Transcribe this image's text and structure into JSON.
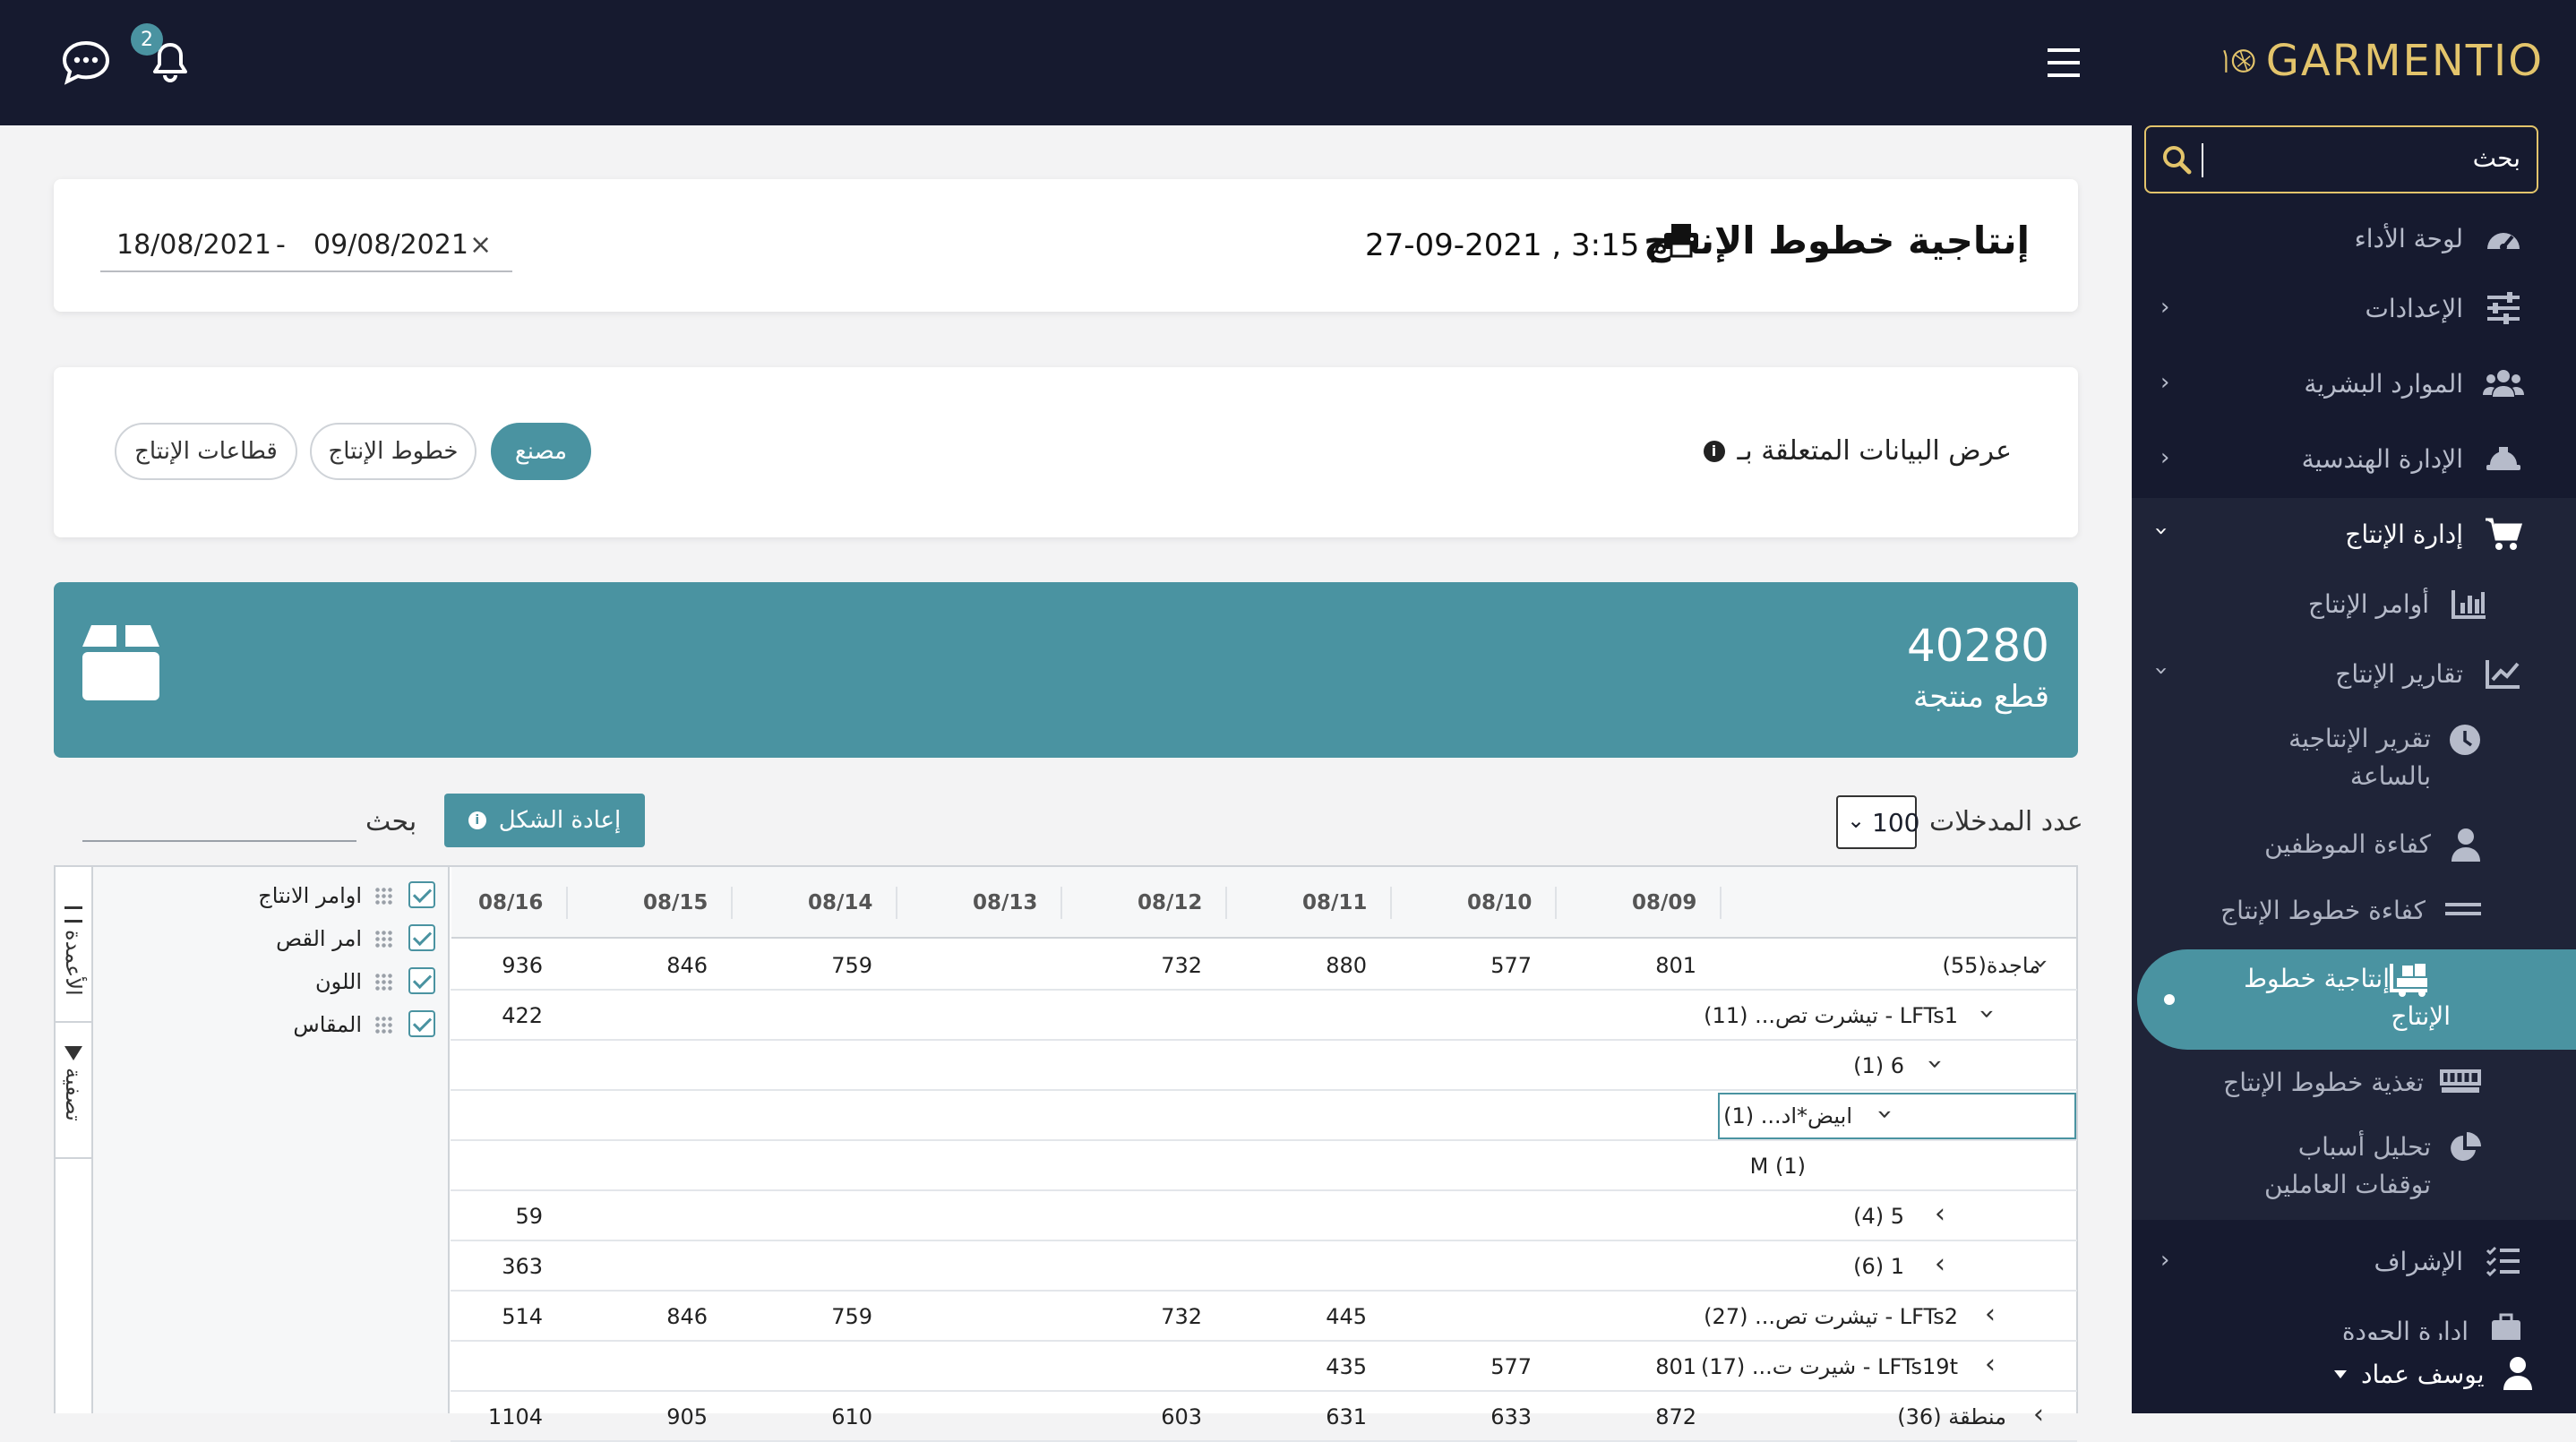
{
  "app": {
    "brand": "GARMENTIO",
    "notification_count": "2"
  },
  "search": {
    "placeholder": "بحث"
  },
  "sidebar": {
    "items": [
      {
        "label": "لوحة الأداء",
        "icon": "dashboard-icon"
      },
      {
        "label": "الإعدادات",
        "icon": "sliders-icon"
      },
      {
        "label": "الموارد البشرية",
        "icon": "users-icon"
      },
      {
        "label": "الإدارة الهندسية",
        "icon": "helmet-icon"
      },
      {
        "label": "إدارة الإنتاج",
        "icon": "cart-icon"
      },
      {
        "label": "أوامر الإنتاج",
        "icon": "bar-chart-icon"
      },
      {
        "label": "تقارير الإنتاج",
        "icon": "line-chart-icon"
      },
      {
        "label": "الإشراف",
        "icon": "checklist-icon"
      },
      {
        "label": "إدارة الجودة",
        "icon": "briefcase-icon"
      }
    ],
    "subitems": {
      "hourly_1": "تقرير الإنتاجية",
      "hourly_2": "بالساعة",
      "emp_eff": "كفاءة الموظفين",
      "line_eff": "كفاءة خطوط الإنتاج",
      "line_prod_1": "إنتاجية خطوط",
      "line_prod_2": "الإنتاج",
      "feeding": "تغذية خطوط الإنتاج",
      "downtime_1": "تحليل أسباب",
      "downtime_2": "توقفات العاملين"
    },
    "user": "يوسف عماد"
  },
  "page": {
    "title": "إنتاجية خطوط الإنتاج",
    "datetime": "27-09-2021 , 3:15 م",
    "date_from": "09/08/2021",
    "date_to": "18/08/2021",
    "date_sep": "-",
    "clear": "×"
  },
  "filter": {
    "label": "عرض البيانات المتعلقة بـ",
    "options": [
      "مصنع",
      "خطوط الإنتاج",
      "قطاعات الإنتاج"
    ],
    "selected": "مصنع"
  },
  "stat": {
    "value": "40280",
    "label": "قطع منتجة"
  },
  "table": {
    "entries_label": "عدد المدخلات",
    "entries_value": "100",
    "reset_label": "إعادة الشكل",
    "search_label": "بحث",
    "columns": [
      "08/09",
      "08/10",
      "08/11",
      "08/12",
      "08/13",
      "08/14",
      "08/15",
      "08/16"
    ],
    "rows": [
      {
        "label": "ماجدة(55)",
        "values": [
          "801",
          "577",
          "880",
          "732",
          "",
          "759",
          "846",
          "936"
        ]
      },
      {
        "label": "LFTs1 - تيشرت تص... (11)",
        "values": [
          "",
          "",
          "",
          "",
          "",
          "",
          "",
          "422"
        ]
      },
      {
        "label": "6 (1)",
        "values": [
          "",
          "",
          "",
          "",
          "",
          "",
          "",
          ""
        ]
      },
      {
        "label": "ابيض*اد... (1)",
        "values": [
          "",
          "",
          "",
          "",
          "",
          "",
          "",
          ""
        ]
      },
      {
        "label": "M (1)",
        "values": [
          "",
          "",
          "",
          "",
          "",
          "",
          "",
          ""
        ]
      },
      {
        "label": "5 (4)",
        "values": [
          "",
          "",
          "",
          "",
          "",
          "",
          "",
          "59"
        ]
      },
      {
        "label": "1 (6)",
        "values": [
          "",
          "",
          "",
          "",
          "",
          "",
          "",
          "363"
        ]
      },
      {
        "label": "LFTs2 - تيشرت تص... (27)",
        "values": [
          "",
          "",
          "445",
          "732",
          "",
          "759",
          "846",
          "514"
        ]
      },
      {
        "label": "LFTs19t - شيرت ت...  (17)",
        "values": [
          "801",
          "577",
          "435",
          "",
          "",
          "",
          "",
          ""
        ]
      },
      {
        "label": "منطقة (36)",
        "values": [
          "872",
          "633",
          "631",
          "603",
          "",
          "610",
          "905",
          "1104"
        ]
      }
    ],
    "side_tabs": {
      "columns": "الأعمدة",
      "filter": "تصفية"
    },
    "group_fields": [
      "اوامر الانتاج",
      "امر القص",
      "اللون",
      "المقاس"
    ]
  }
}
